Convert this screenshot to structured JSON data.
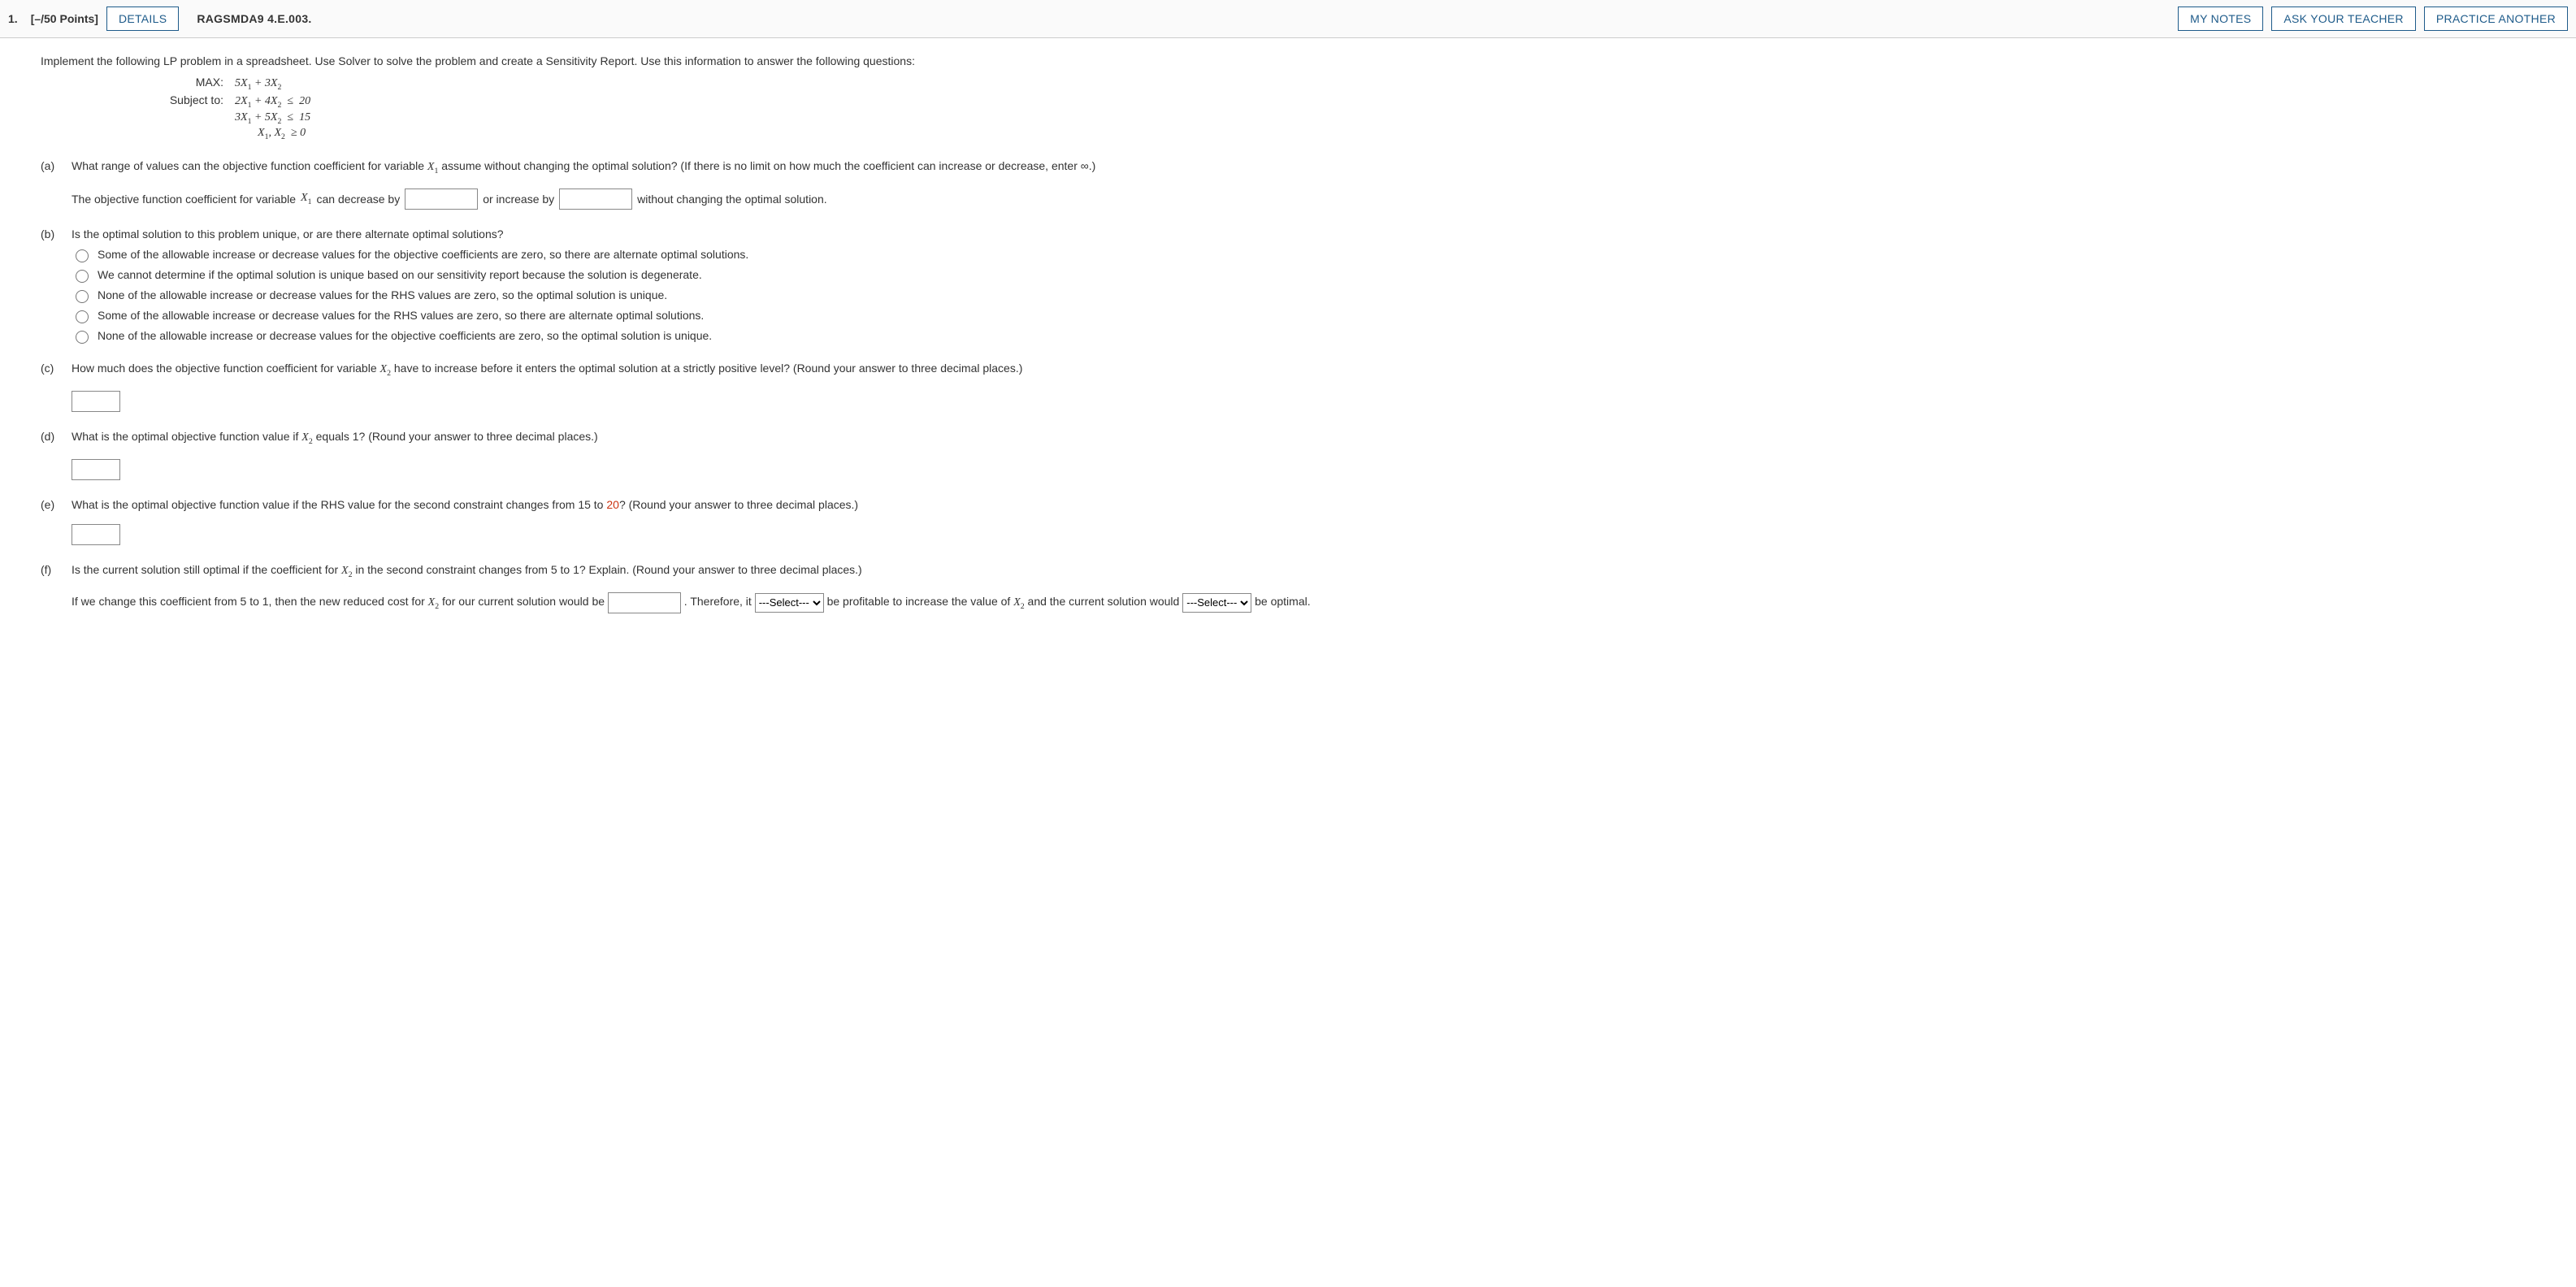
{
  "header": {
    "qnum": "1.",
    "points": "[–/50 Points]",
    "details": "DETAILS",
    "problem_id": "RAGSMDA9 4.E.003.",
    "mynotes": "MY NOTES",
    "ask": "ASK YOUR TEACHER",
    "practice": "PRACTICE ANOTHER"
  },
  "intro": "Implement the following LP problem in a spreadsheet. Use Solver to solve the problem and create a Sensitivity Report. Use this information to answer the following questions:",
  "lp": {
    "max_label": "MAX:",
    "subj_label": "Subject to:",
    "obj_c1": "5",
    "obj_c2": "3",
    "c1_a1": "2",
    "c1_a2": "4",
    "c1_rhs": "20",
    "c2_a1": "3",
    "c2_a2": "5",
    "c2_rhs": "15",
    "nn": "≥ 0"
  },
  "a": {
    "label": "(a)",
    "q": "What range of values can the objective function coefficient for variable ",
    "q2": " assume without changing the optimal solution? (If there is no limit on how much the coefficient can increase or decrease, enter ∞.)",
    "line1": "The objective function coefficient for variable ",
    "line2": " can decrease by ",
    "line3": " or increase by ",
    "line4": " without changing the optimal solution."
  },
  "b": {
    "label": "(b)",
    "q": "Is the optimal solution to this problem unique, or are there alternate optimal solutions?",
    "opts": [
      "Some of the allowable increase or decrease values for the objective coefficients are zero, so there are alternate optimal solutions.",
      "We cannot determine if the optimal solution is unique based on our sensitivity report because the solution is degenerate.",
      "None of the allowable increase or decrease values for the RHS values are zero, so the optimal solution is unique.",
      "Some of the allowable increase or decrease values for the RHS values are zero, so there are alternate optimal solutions.",
      "None of the allowable increase or decrease values for the objective coefficients are zero, so the optimal solution is unique."
    ]
  },
  "c": {
    "label": "(c)",
    "q1": "How much does the objective function coefficient for variable ",
    "q2": " have to increase before it enters the optimal solution at a strictly positive level? (Round your answer to three decimal places.)"
  },
  "d": {
    "label": "(d)",
    "q1": "What is the optimal objective function value if ",
    "q2": " equals 1? (Round your answer to three decimal places.)"
  },
  "e": {
    "label": "(e)",
    "q1": "What is the optimal objective function value if the RHS value for the second constraint changes from 15 to ",
    "rhs_new": "20",
    "q2": "? (Round your answer to three decimal places.)"
  },
  "f": {
    "label": "(f)",
    "q1": "Is the current solution still optimal if the coefficient for ",
    "q2": " in the second constraint changes from 5 to 1? Explain. (Round your answer to three decimal places.)",
    "s1": "If we change this coefficient from 5 to 1, then the new reduced cost for ",
    "s2": " for our current solution would be ",
    "s3": " . Therefore, it ",
    "s4": " be profitable to increase the value of ",
    "s5": " and the current solution would ",
    "s6": " be optimal.",
    "select_placeholder": "---Select---"
  }
}
